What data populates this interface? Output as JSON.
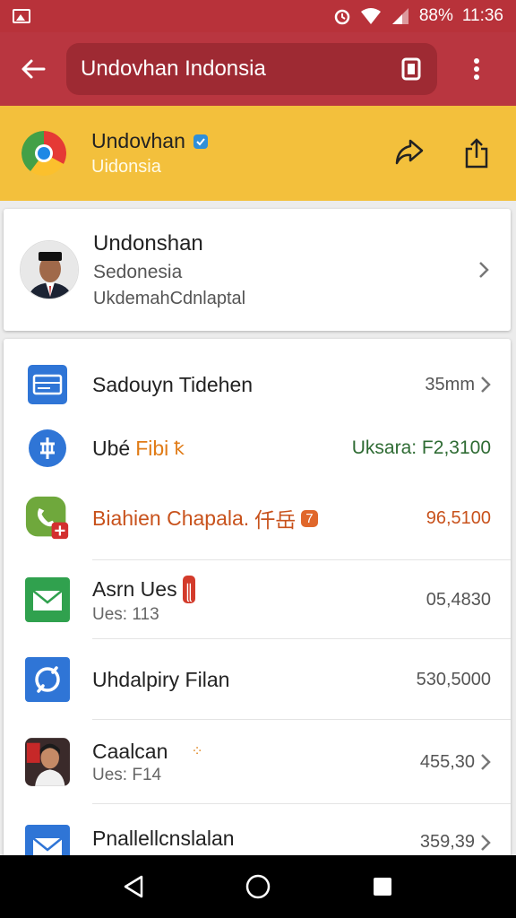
{
  "status_bar": {
    "battery": "88%",
    "time": "11:36"
  },
  "toolbar": {
    "search_text": "Undovhan Indonsia"
  },
  "app": {
    "name": "Undovhan",
    "subtitle": "Uidonsia"
  },
  "profile": {
    "name": "Undonshan",
    "line1": "Sedonesia",
    "line2": "UkdemahCdnlaptal"
  },
  "list": [
    {
      "title": "Sadouyn Tidehen",
      "sub": "",
      "value": "35mm",
      "icon": "card-icon"
    },
    {
      "title": "Ubé ",
      "title_accent": "Fibi ",
      "title_extra": "ꝁ",
      "sub": "",
      "value": "Uksara: F2,3100",
      "icon": "globe-icon"
    },
    {
      "title": "Biahien Chapala.",
      "title_extra": "仟岳",
      "badge": "7",
      "sub": "",
      "value": "96,5100",
      "icon": "phone-icon"
    },
    {
      "title": "Asrn Ues",
      "badge": "꧋",
      "sub": "Ues: 113",
      "value": "05,4830",
      "icon": "mail-icon"
    },
    {
      "title": "Uhdalpiry Filan",
      "sub": "",
      "value": "530,5000",
      "icon": "lens-icon"
    },
    {
      "title": "Caalcan",
      "sub": "Ues: F14",
      "value": "455,30",
      "icon": "photo-icon"
    },
    {
      "title": "Pnallellcnslalan",
      "sub": "",
      "value": "359,39",
      "icon": "mail-blue-icon"
    }
  ],
  "colors": {
    "status_bar": "#b8323a",
    "toolbar": "#b93640",
    "banner": "#f3c03c",
    "green_value": "#2e6b33",
    "orange_value": "#c8521c"
  }
}
